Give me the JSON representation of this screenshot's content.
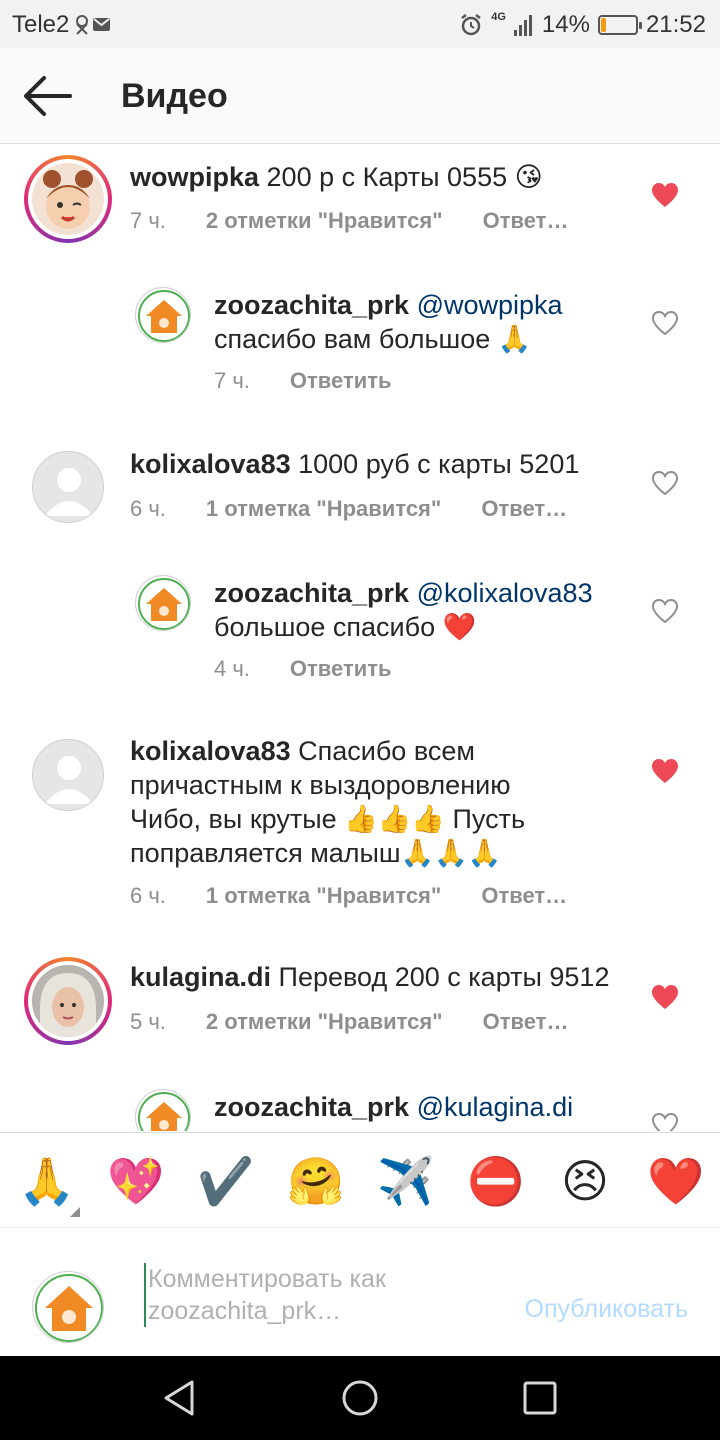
{
  "status_bar": {
    "carrier": "Tele2",
    "network": "4G",
    "battery_percent": "14%",
    "battery_level": 0.14,
    "time": "21:52"
  },
  "header": {
    "title": "Видео",
    "back_icon": "arrow-left-icon"
  },
  "comments": [
    {
      "username": "wowpipka",
      "mention": "",
      "text": "200 р с Карты 0555 😘",
      "time": "7 ч.",
      "likes": "2 отметки \"Нравится\"",
      "reply": "Ответ…",
      "liked": true
    },
    {
      "username": "zoozachita_prk",
      "mention": "@wowpipka",
      "text": "спасибо вам большое 🙏",
      "time": "7 ч.",
      "likes": "",
      "reply": "Ответить",
      "liked": false
    },
    {
      "username": "kolixalova83",
      "mention": "",
      "text": "1000 руб с карты 5201",
      "time": "6 ч.",
      "likes": "1 отметка \"Нравится\"",
      "reply": "Ответ…",
      "liked": false
    },
    {
      "username": "zoozachita_prk",
      "mention": "@kolixalova83",
      "text": "большое спасибо ❤️",
      "time": "4 ч.",
      "likes": "",
      "reply": "Ответить",
      "liked": false
    },
    {
      "username": "kolixalova83",
      "mention": "",
      "text_line1": "Спасибо всем",
      "text_line2": "причастным к выздоровлению",
      "text_line3": "Чибо, вы крутые 👍👍👍 Пусть",
      "text_line4": "поправляется малыш🙏🙏🙏",
      "time": "6 ч.",
      "likes": "1 отметка \"Нравится\"",
      "reply": "Ответ…",
      "liked": true
    },
    {
      "username": "kulagina.di",
      "mention": "",
      "text": "Перевод 200 с карты 9512",
      "time": "5 ч.",
      "likes": "2 отметки \"Нравится\"",
      "reply": "Ответ…",
      "liked": true
    },
    {
      "username": "zoozachita_prk",
      "mention": "@kulagina.di",
      "text": "",
      "liked": false
    }
  ],
  "emoji_bar": [
    "🙏",
    "💖",
    "✔️",
    "🤗",
    "✈️",
    "⛔",
    "😣",
    "❤️"
  ],
  "compose": {
    "placeholder_line1": "Комментировать как",
    "placeholder_line2": "zoozachita_prk…",
    "publish_label": "Опубликовать"
  },
  "colors": {
    "like_red": "#ed4956",
    "mention_blue": "#003569",
    "publish_disabled": "#b3dbff",
    "meta_gray": "#8e8e8e"
  }
}
